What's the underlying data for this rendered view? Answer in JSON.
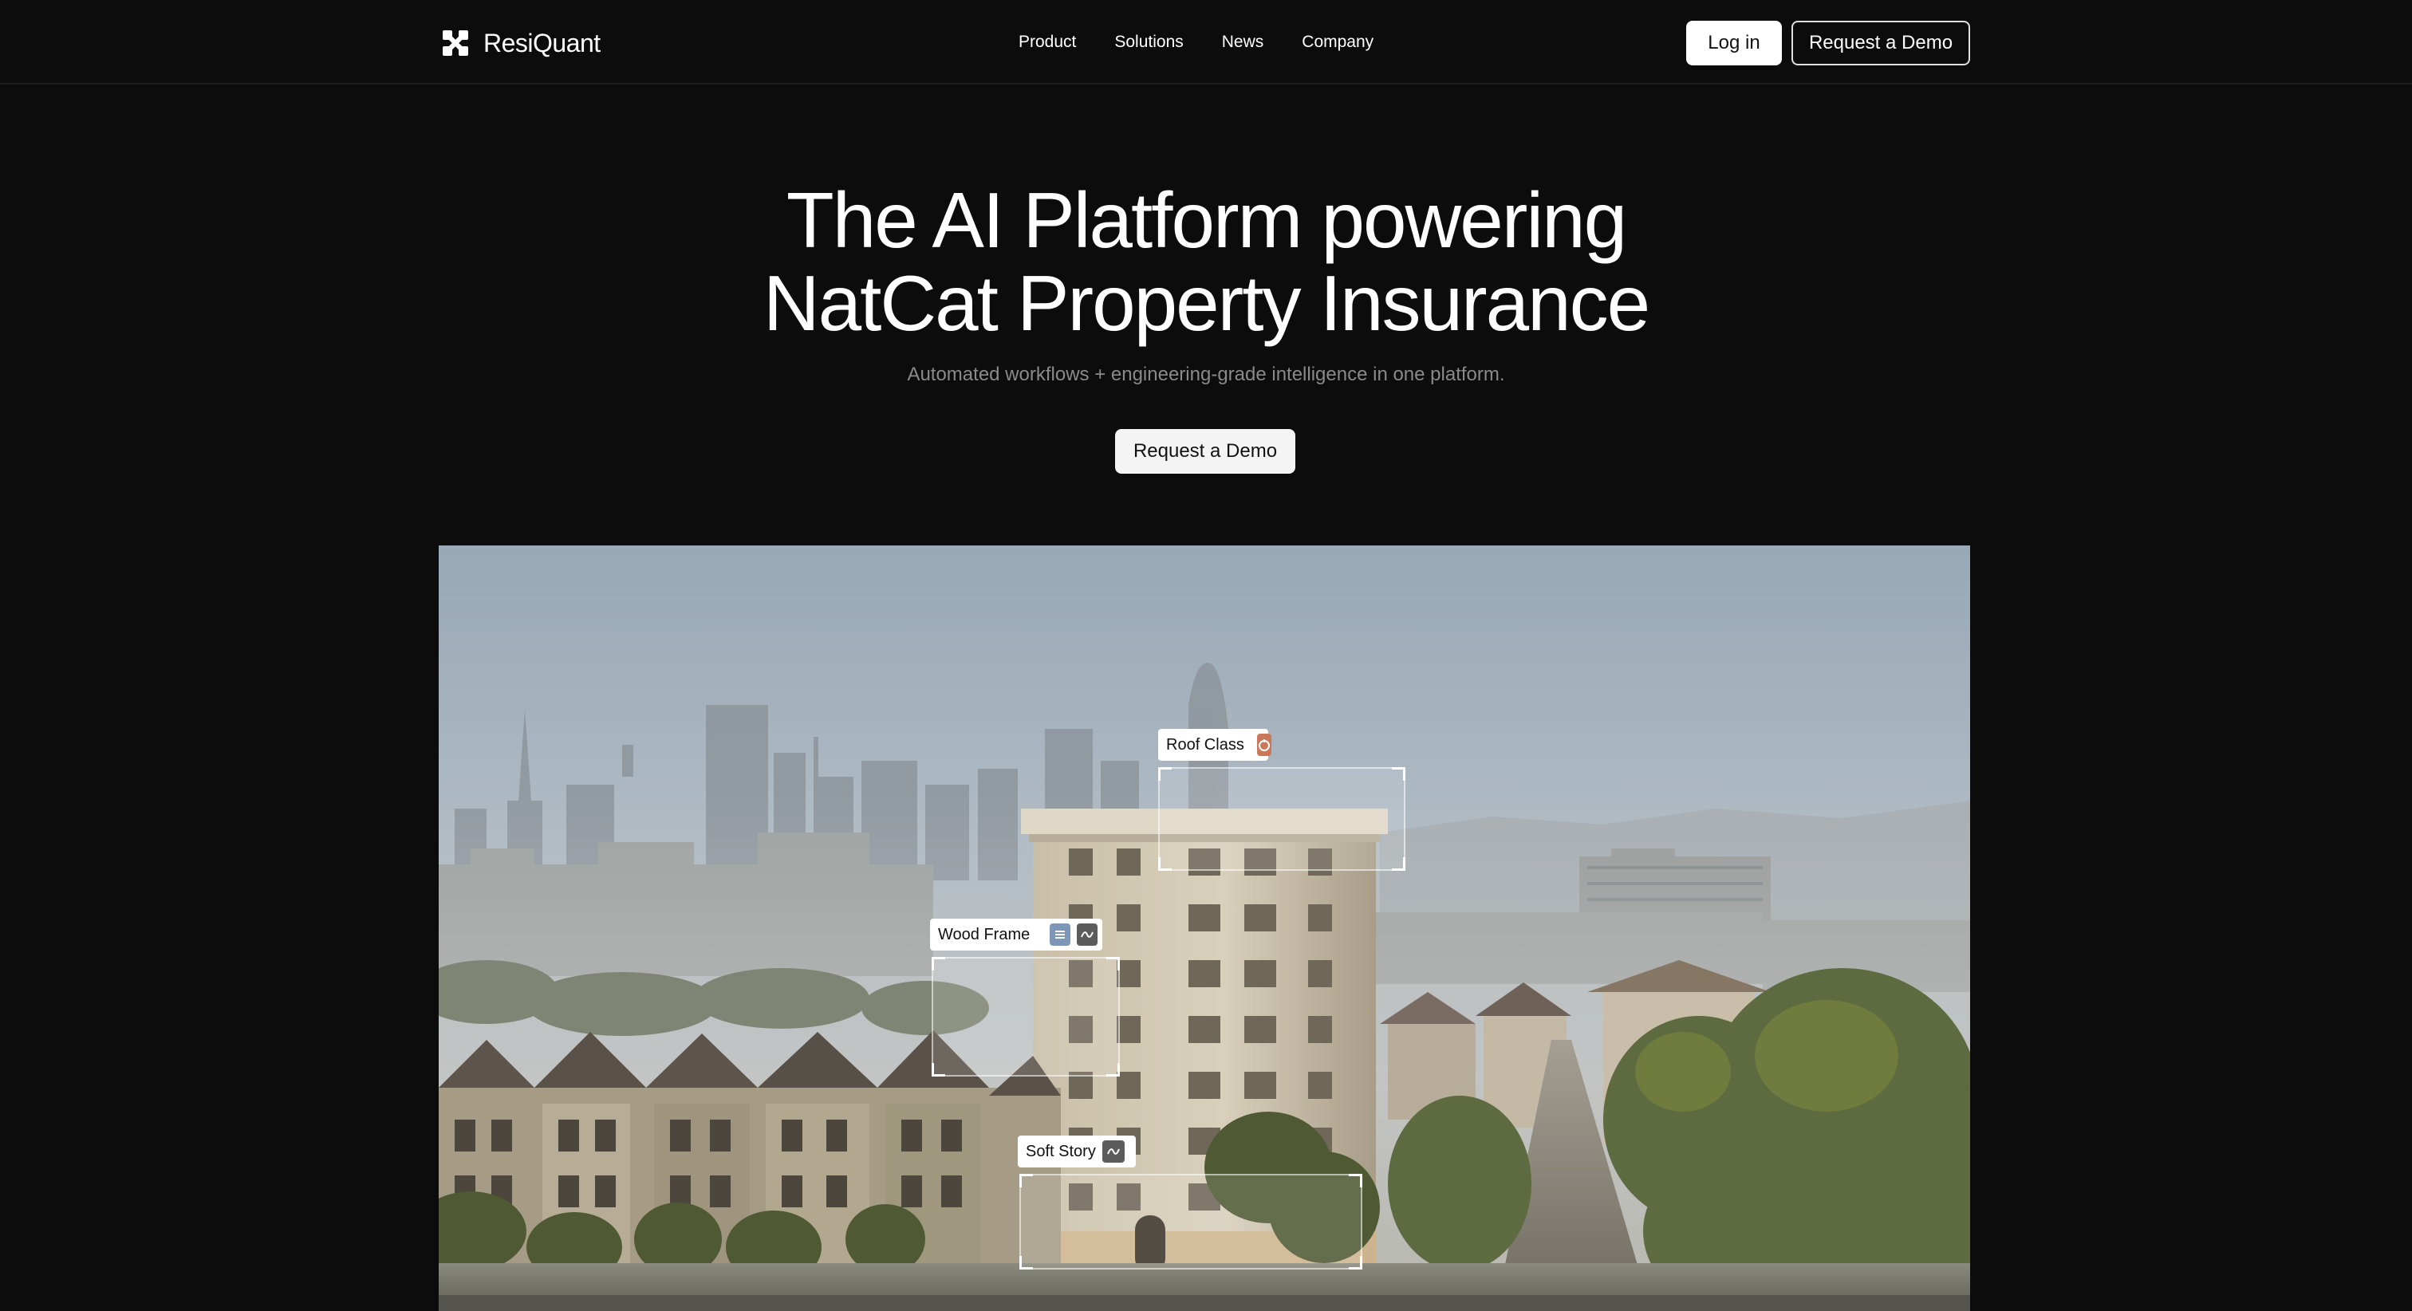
{
  "brand": {
    "name": "ResiQuant"
  },
  "nav": {
    "links": [
      "Product",
      "Solutions",
      "News",
      "Company"
    ],
    "login_label": "Log in",
    "demo_label": "Request a Demo"
  },
  "hero": {
    "title_line1": "The AI Platform powering",
    "title_line2": "NatCat Property Insurance",
    "subtitle": "Automated workflows + engineering-grade intelligence in one platform.",
    "cta_label": "Request a Demo"
  },
  "annotations": {
    "roof_class": {
      "label": "Roof Class",
      "icons": [
        "roof-type-icon"
      ],
      "icon_color": "#c9785a"
    },
    "wood_frame": {
      "label": "Wood Frame",
      "icons": [
        "list-icon",
        "wave-icon"
      ],
      "icon_colors": [
        "#7e97b8",
        "#5c5c5c"
      ]
    },
    "soft_story": {
      "label": "Soft Story",
      "icons": [
        "wave-icon"
      ],
      "icon_color": "#5c5c5c"
    }
  },
  "colors": {
    "background": "#0c0c0c",
    "text": "#ffffff",
    "muted": "#8a8a8a",
    "button_light": "#f4f4f4"
  }
}
